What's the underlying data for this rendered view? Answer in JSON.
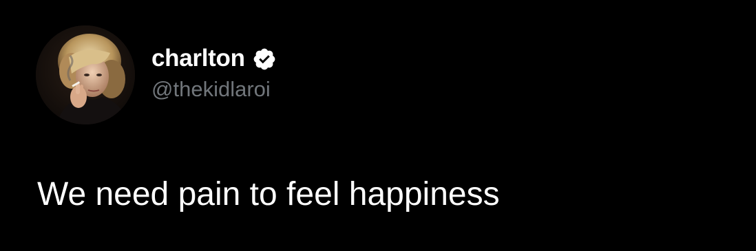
{
  "tweet": {
    "author": {
      "display_name": "charlton",
      "handle": "@thekidlaroi",
      "verified": true,
      "avatar_icon": "profile-photo"
    },
    "text": "We need pain to feel happiness"
  },
  "colors": {
    "background": "#000000",
    "primary_text": "#ffffff",
    "secondary_text": "#71767b"
  }
}
